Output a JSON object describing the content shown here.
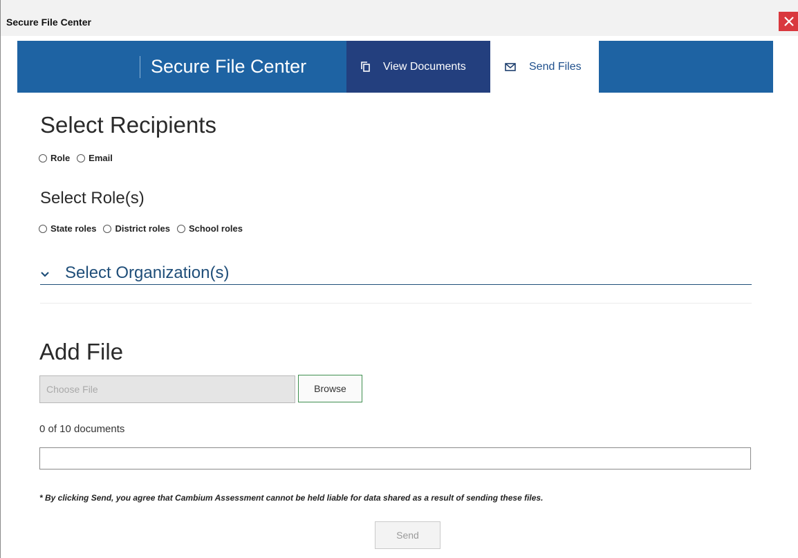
{
  "window": {
    "title": "Secure File Center",
    "close_icon": "close-icon"
  },
  "navbar": {
    "brand": "Secure File Center",
    "tabs": [
      {
        "label": "View Documents",
        "icon": "copy-icon",
        "active": false
      },
      {
        "label": "Send Files",
        "icon": "envelope-icon",
        "active": true
      }
    ]
  },
  "recipients": {
    "heading": "Select Recipients",
    "options": [
      {
        "label": "Role",
        "checked": false
      },
      {
        "label": "Email",
        "checked": false
      }
    ]
  },
  "roles": {
    "heading": "Select Role(s)",
    "options": [
      {
        "label": "State roles",
        "checked": false
      },
      {
        "label": "District roles",
        "checked": false
      },
      {
        "label": "School roles",
        "checked": false
      }
    ]
  },
  "organization": {
    "label": "Select Organization(s)",
    "icon": "chevron-down-icon"
  },
  "add_file": {
    "heading": "Add File",
    "placeholder": "Choose File",
    "browse_label": "Browse",
    "doc_count": "0 of 10 documents"
  },
  "disclaimer": "* By clicking Send, you agree that Cambium Assessment cannot be held liable for data shared as a result of sending these files.",
  "send_label": "Send",
  "colors": {
    "nav_bg": "#1e63a3",
    "nav_active_tab": "#233f7e",
    "close": "#d9383e",
    "browse_border": "#3f8f4f",
    "heading_link": "#1f4e79"
  }
}
